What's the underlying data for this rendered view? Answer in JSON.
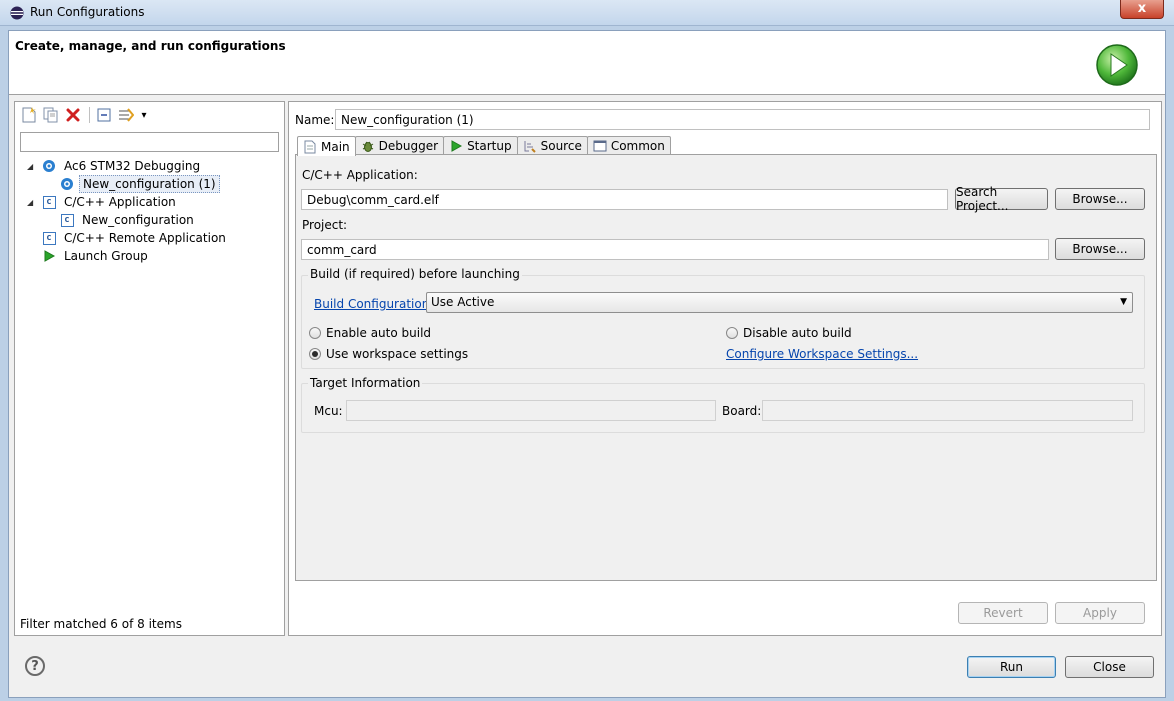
{
  "window": {
    "title": "Run Configurations",
    "close": "x"
  },
  "header": {
    "title": "Create, manage, and run configurations"
  },
  "toolbar": {
    "dropdown_glyph": "▾"
  },
  "tree": {
    "filter_placeholder": "",
    "items": [
      {
        "label": "Ac6 STM32 Debugging",
        "arrow": "◢"
      },
      {
        "label": "New_configuration (1)"
      },
      {
        "label": "C/C++ Application",
        "arrow": "◢"
      },
      {
        "label": "New_configuration"
      },
      {
        "label": "C/C++ Remote Application"
      },
      {
        "label": "Launch Group"
      }
    ],
    "status": "Filter matched 6 of 8 items"
  },
  "name": {
    "label": "Name:",
    "value": "New_configuration (1)"
  },
  "tabs": [
    {
      "label": "Main",
      "icon": "page-icon"
    },
    {
      "label": "Debugger",
      "icon": "bug-icon"
    },
    {
      "label": "Startup",
      "icon": "play-icon"
    },
    {
      "label": "Source",
      "icon": "source-icon"
    },
    {
      "label": "Common",
      "icon": "common-icon"
    }
  ],
  "main": {
    "app_label": "C/C++ Application:",
    "app_value": "Debug\\comm_card.elf",
    "search_project": "Search Project...",
    "browse": "Browse...",
    "project_label": "Project:",
    "project_value": "comm_card",
    "build_group": "Build (if required) before launching",
    "build_config_link": "Build Configuration:",
    "build_config_value": "Use Active",
    "enable_auto": "Enable auto build",
    "disable_auto": "Disable auto build",
    "use_workspace": "Use workspace settings",
    "configure_link": "Configure Workspace Settings...",
    "target_group": "Target Information",
    "mcu_label": "Mcu:",
    "mcu_value": "",
    "board_label": "Board:",
    "board_value": ""
  },
  "actions": {
    "revert": "Revert",
    "apply": "Apply",
    "run": "Run",
    "close": "Close",
    "help": "?"
  },
  "colors": {
    "accent": "#0645ad",
    "run_green": "#2aa52a"
  }
}
